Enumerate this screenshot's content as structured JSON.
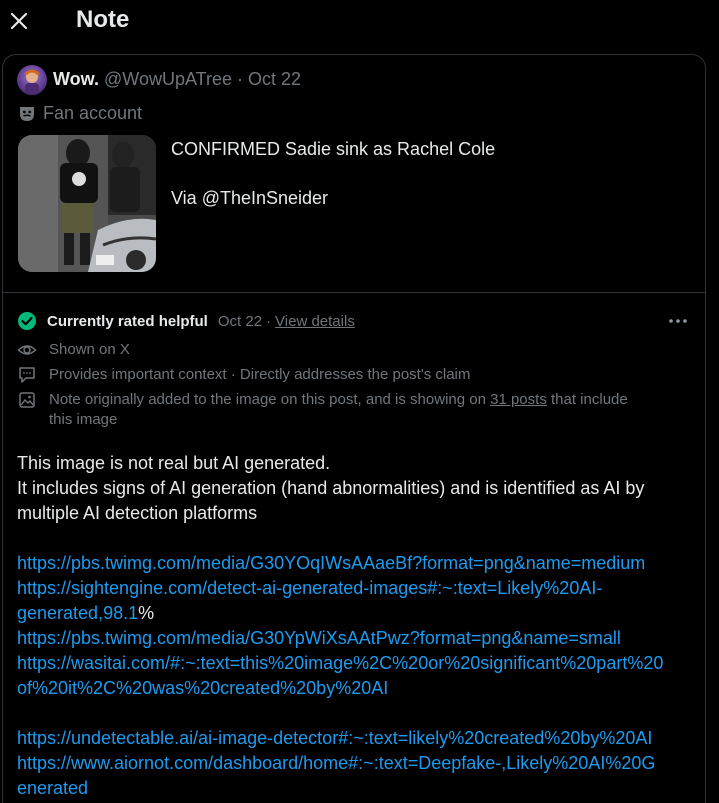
{
  "header": {
    "title": "Note"
  },
  "post": {
    "author_name": "Wow.",
    "author_handle": "@WowUpATree",
    "date_sep": " · ",
    "date": "Oct 22",
    "badge": "Fan account",
    "text_line1": "CONFIRMED Sadie sink as Rachel Cole",
    "text_line2": "Via @TheInSneider"
  },
  "note": {
    "status": "Currently rated helpful",
    "date": "Oct 22",
    "dot": "·",
    "view_details": "View details",
    "shown_on": "Shown on X",
    "reasons": "Provides important context · Directly addresses the post's claim",
    "image_note_pre": "Note originally added to the image on this post, and is showing on ",
    "image_note_link": "31 posts",
    "image_note_post": " that include",
    "image_note_line2": "this image",
    "body": {
      "line1": "This image is not real but AI generated.",
      "line2": "It includes signs of AI generation (hand abnormalities) and is identified as AI by",
      "line3": "multiple AI detection platforms",
      "link1": "https://pbs.twimg.com/media/G30YOqIWsAAaeBf?format=png&name=medium",
      "link2a": "https://sightengine.com/detect-ai-generated-images#:~:text=Likely%20AI-",
      "link2b": "generated,98.1",
      "link2c": "%",
      "link3": "https://pbs.twimg.com/media/G30YpWiXsAAtPwz?format=png&name=small",
      "link4a": "https://wasitai.com/#:~:text=this%20image%2C%20or%20significant%20part%20",
      "link4b": "of%20it%2C%20was%20created%20by%20AI",
      "link5": "https://undetectable.ai/ai-image-detector#:~:text=likely%20created%20by%20AI",
      "link6a": "https://www.aiornot.com/dashboard/home#:~:text=Deepfake-,Likely%20AI%20G",
      "link6b": "enerated"
    }
  },
  "colors": {
    "accent_link": "#1d9bf0",
    "helpful_green": "#00ba7c",
    "muted": "#71767b"
  }
}
